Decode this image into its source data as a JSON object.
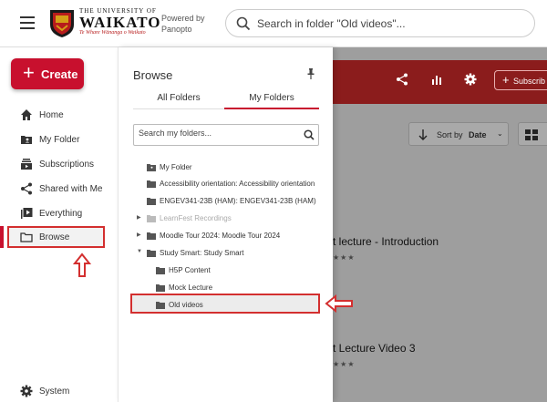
{
  "header": {
    "logo_univ": "THE UNIVERSITY OF",
    "logo_name": "WAIKATO",
    "logo_tagline": "Te Whare Wānanga o Waikato",
    "powered_line1": "Powered by",
    "powered_line2": "Panopto",
    "search_placeholder": "Search in folder \"Old videos\"..."
  },
  "sidebar": {
    "create_label": "Create",
    "items": [
      {
        "label": "Home",
        "icon": "home-icon"
      },
      {
        "label": "My Folder",
        "icon": "folder-user-icon"
      },
      {
        "label": "Subscriptions",
        "icon": "subscriptions-icon"
      },
      {
        "label": "Shared with Me",
        "icon": "share-icon"
      },
      {
        "label": "Everything",
        "icon": "play-list-icon"
      },
      {
        "label": "Browse",
        "icon": "folder-outline-icon"
      }
    ],
    "system_label": "System"
  },
  "browse_panel": {
    "title": "Browse",
    "tab_all": "All Folders",
    "tab_my": "My Folders",
    "search_placeholder": "Search my folders...",
    "folders": [
      {
        "label": "My Folder",
        "indent": 0,
        "arrow": ""
      },
      {
        "label": "Accessibility orientation: Accessibility orientation",
        "indent": 0,
        "arrow": ""
      },
      {
        "label": "ENGEV341-23B (HAM): ENGEV341-23B (HAM)",
        "indent": 0,
        "arrow": ""
      },
      {
        "label": "LearnFest Recordings",
        "indent": 0,
        "arrow": "▶"
      },
      {
        "label": "Moodle Tour 2024: Moodle Tour 2024",
        "indent": 0,
        "arrow": "▶"
      },
      {
        "label": "Study Smart: Study Smart",
        "indent": 0,
        "arrow": "▼"
      },
      {
        "label": "H5P Content",
        "indent": 1,
        "arrow": ""
      },
      {
        "label": "Mock Lecture",
        "indent": 1,
        "arrow": ""
      },
      {
        "label": "Old videos",
        "indent": 1,
        "arrow": ""
      }
    ]
  },
  "main": {
    "subscribe_label": "Subscrib",
    "sort_prefix": "Sort by",
    "sort_value": "Date",
    "videos": [
      {
        "title": "t lecture - Introduction",
        "stars": "★★★"
      },
      {
        "title": "t Lecture Video 3",
        "stars": "★★★"
      }
    ]
  },
  "colors": {
    "brand_red": "#c8102e",
    "annotation_red": "#d32f2f",
    "header_bar": "#8b1c1c"
  }
}
